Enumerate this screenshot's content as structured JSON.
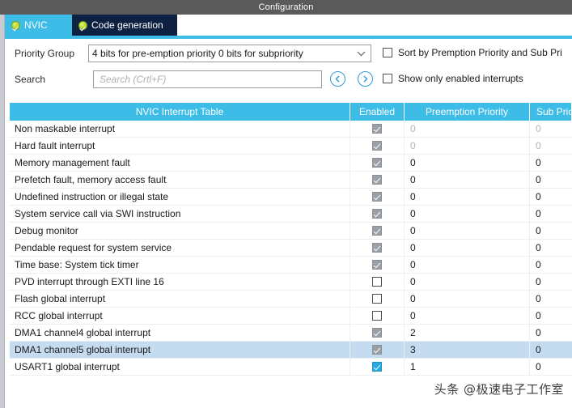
{
  "window": {
    "title": "Configuration"
  },
  "tabs": [
    {
      "label": "NVIC",
      "icon": "check-circle-icon",
      "active": true
    },
    {
      "label": "Code generation",
      "icon": "check-circle-icon",
      "active": false
    }
  ],
  "controls": {
    "priority_group_label": "Priority Group",
    "priority_group_value": "4 bits for pre-emption priority 0 bits for subpriority",
    "search_label": "Search",
    "search_value": "",
    "search_placeholder": "Search (Crtl+F)",
    "prev_icon": "chevron-left-circle-icon",
    "next_icon": "chevron-right-circle-icon",
    "sort_checkbox_label": "Sort by Premption Priority and Sub Pri",
    "sort_checkbox_checked": false,
    "show_enabled_checkbox_label": "Show only enabled interrupts",
    "show_enabled_checkbox_checked": false
  },
  "table": {
    "headers": [
      "NVIC Interrupt Table",
      "Enabled",
      "Preemption Priority",
      "Sub Prio"
    ],
    "rows": [
      {
        "name": "Non maskable interrupt",
        "enabled": "disabled-checked",
        "preemption": "0",
        "sub": "0",
        "dim": true,
        "selected": false
      },
      {
        "name": "Hard fault interrupt",
        "enabled": "disabled-checked",
        "preemption": "0",
        "sub": "0",
        "dim": true,
        "selected": false
      },
      {
        "name": "Memory management fault",
        "enabled": "disabled-checked",
        "preemption": "0",
        "sub": "0",
        "dim": false,
        "selected": false
      },
      {
        "name": "Prefetch fault, memory access fault",
        "enabled": "disabled-checked",
        "preemption": "0",
        "sub": "0",
        "dim": false,
        "selected": false
      },
      {
        "name": "Undefined instruction or illegal state",
        "enabled": "disabled-checked",
        "preemption": "0",
        "sub": "0",
        "dim": false,
        "selected": false
      },
      {
        "name": "System service call via SWI instruction",
        "enabled": "disabled-checked",
        "preemption": "0",
        "sub": "0",
        "dim": false,
        "selected": false
      },
      {
        "name": "Debug monitor",
        "enabled": "disabled-checked",
        "preemption": "0",
        "sub": "0",
        "dim": false,
        "selected": false
      },
      {
        "name": "Pendable request for system service",
        "enabled": "disabled-checked",
        "preemption": "0",
        "sub": "0",
        "dim": false,
        "selected": false
      },
      {
        "name": "Time base: System tick timer",
        "enabled": "disabled-checked",
        "preemption": "0",
        "sub": "0",
        "dim": false,
        "selected": false
      },
      {
        "name": "PVD interrupt through EXTI line 16",
        "enabled": "unchecked",
        "preemption": "0",
        "sub": "0",
        "dim": false,
        "selected": false
      },
      {
        "name": "Flash global interrupt",
        "enabled": "unchecked",
        "preemption": "0",
        "sub": "0",
        "dim": false,
        "selected": false
      },
      {
        "name": "RCC global interrupt",
        "enabled": "unchecked",
        "preemption": "0",
        "sub": "0",
        "dim": false,
        "selected": false
      },
      {
        "name": "DMA1 channel4 global interrupt",
        "enabled": "disabled-checked",
        "preemption": "2",
        "sub": "0",
        "dim": false,
        "selected": false
      },
      {
        "name": "DMA1 channel5 global interrupt",
        "enabled": "disabled-checked",
        "preemption": "3",
        "sub": "0",
        "dim": false,
        "selected": true
      },
      {
        "name": "USART1 global interrupt",
        "enabled": "active-checked",
        "preemption": "1",
        "sub": "0",
        "dim": false,
        "selected": false
      }
    ]
  },
  "watermark": {
    "text": "头条 @极速电子工作室"
  },
  "colors": {
    "accent": "#3dbce8",
    "tab_active_bg": "#3dbce8",
    "tab_inactive_bg": "#0d2143",
    "titlebar_bg": "#5a5a5a",
    "row_selected": "#c5dcf0",
    "checkbox_active": "#29a8e0",
    "checkbox_disabled": "#9aa0a6"
  }
}
